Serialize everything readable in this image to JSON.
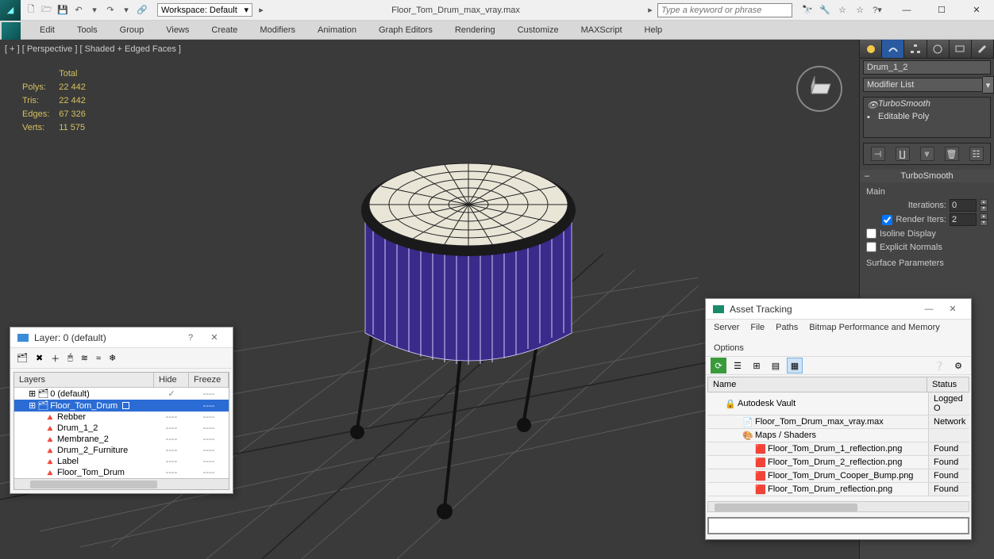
{
  "title_file": "Floor_Tom_Drum_max_vray.max",
  "workspace_label": "Workspace: Default",
  "search_placeholder": "Type a keyword or phrase",
  "menus": [
    "Edit",
    "Tools",
    "Group",
    "Views",
    "Create",
    "Modifiers",
    "Animation",
    "Graph Editors",
    "Rendering",
    "Customize",
    "MAXScript",
    "Help"
  ],
  "viewport": {
    "label": "[ + ] [ Perspective ] [ Shaded + Edged Faces ]",
    "stats_header": "Total",
    "stats": [
      {
        "k": "Polys:",
        "v": "22 442"
      },
      {
        "k": "Tris:",
        "v": "22 442"
      },
      {
        "k": "Edges:",
        "v": "67 326"
      },
      {
        "k": "Verts:",
        "v": "11 575"
      }
    ]
  },
  "cmd": {
    "object_name": "Drum_1_2",
    "modlist_label": "Modifier List",
    "stack": [
      {
        "name": "TurboSmooth",
        "italic": true,
        "eye": true
      },
      {
        "name": "Editable Poly",
        "italic": false,
        "eye": false
      }
    ],
    "rollout_title": "TurboSmooth",
    "main_label": "Main",
    "iterations_label": "Iterations:",
    "iterations_value": "0",
    "render_iters_label": "Render Iters:",
    "render_iters_value": "2",
    "isoline_label": "Isoline Display",
    "explicit_label": "Explicit Normals",
    "surface_label": "Surface Parameters"
  },
  "layer_dialog": {
    "title": "Layer: 0 (default)",
    "cols": [
      "Layers",
      "Hide",
      "Freeze"
    ],
    "rows": [
      {
        "lvl": 1,
        "icon": "layer",
        "name": "0 (default)",
        "hide": "✓",
        "freeze": "----",
        "sel": false,
        "box": false
      },
      {
        "lvl": 1,
        "icon": "layer",
        "name": "Floor_Tom_Drum",
        "hide": "",
        "freeze": "----",
        "sel": true,
        "box": true
      },
      {
        "lvl": 2,
        "icon": "obj",
        "name": "Rebber",
        "hide": "----",
        "freeze": "----",
        "sel": false
      },
      {
        "lvl": 2,
        "icon": "obj",
        "name": "Drum_1_2",
        "hide": "----",
        "freeze": "----",
        "sel": false
      },
      {
        "lvl": 2,
        "icon": "obj",
        "name": "Membrane_2",
        "hide": "----",
        "freeze": "----",
        "sel": false
      },
      {
        "lvl": 2,
        "icon": "obj",
        "name": "Drum_2_Furniture",
        "hide": "----",
        "freeze": "----",
        "sel": false
      },
      {
        "lvl": 2,
        "icon": "obj",
        "name": "Label",
        "hide": "----",
        "freeze": "----",
        "sel": false
      },
      {
        "lvl": 2,
        "icon": "obj",
        "name": "Floor_Tom_Drum",
        "hide": "----",
        "freeze": "----",
        "sel": false
      }
    ]
  },
  "asset_dialog": {
    "title": "Asset Tracking",
    "menus": [
      "Server",
      "File",
      "Paths",
      "Bitmap Performance and Memory",
      "Options"
    ],
    "cols": [
      "Name",
      "Status"
    ],
    "rows": [
      {
        "ind": 1,
        "icon": "vault",
        "name": "Autodesk Vault",
        "status": "Logged O"
      },
      {
        "ind": 2,
        "icon": "max",
        "name": "Floor_Tom_Drum_max_vray.max",
        "status": "Network"
      },
      {
        "ind": 2,
        "icon": "maps",
        "name": "Maps / Shaders",
        "status": ""
      },
      {
        "ind": 3,
        "icon": "png",
        "name": "Floor_Tom_Drum_1_reflection.png",
        "status": "Found"
      },
      {
        "ind": 3,
        "icon": "png",
        "name": "Floor_Tom_Drum_2_reflection.png",
        "status": "Found"
      },
      {
        "ind": 3,
        "icon": "png",
        "name": "Floor_Tom_Drum_Cooper_Bump.png",
        "status": "Found"
      },
      {
        "ind": 3,
        "icon": "png",
        "name": "Floor_Tom_Drum_reflection.png",
        "status": "Found"
      }
    ]
  }
}
